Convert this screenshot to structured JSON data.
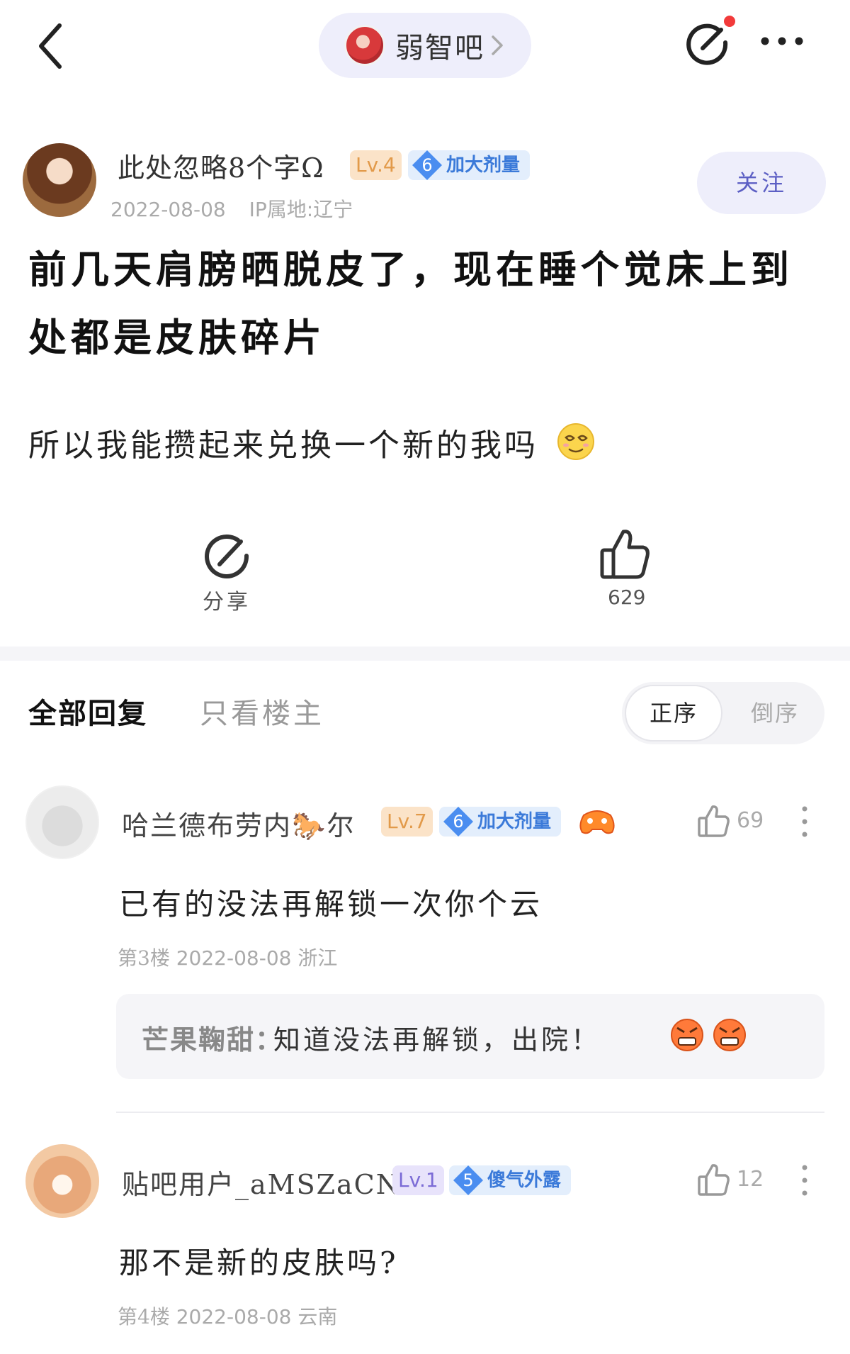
{
  "topbar": {
    "forum_name": "弱智吧",
    "icons": [
      "back-icon",
      "chevron-right-icon",
      "share-icon",
      "more-icon"
    ]
  },
  "author": {
    "name": "此处忽略8个字Ω",
    "level": "Lv.4",
    "title_level": "6",
    "title": "加大剂量",
    "date": "2022-08-08",
    "ip": "IP属地:辽宁",
    "follow_label": "关注"
  },
  "post": {
    "title": "前几天肩膀晒脱皮了，现在睡个觉床上到处都是皮肤碎片",
    "body": "所以我能攒起来兑换一个新的我吗"
  },
  "actions": {
    "share_label": "分享",
    "like_count": "629"
  },
  "tabs": {
    "all": "全部回复",
    "op_only": "只看楼主",
    "sort_asc": "正序",
    "sort_desc": "倒序"
  },
  "replies": [
    {
      "name": "哈兰德布劳内🐎尔",
      "level": "Lv.7",
      "title_level": "6",
      "title": "加大剂量",
      "likes": "69",
      "text": "已有的没法再解锁一次你个云",
      "floor": "第3楼",
      "date": "2022-08-08",
      "location": "浙江",
      "sub_reply": {
        "user": "芒果鞠甜：",
        "text": "知道没法再解锁，出院！"
      }
    },
    {
      "name": "贴吧用户_aMSZaCN",
      "level": "Lv.1",
      "title_level": "5",
      "title": "傻气外露",
      "likes": "12",
      "text": "那不是新的皮肤吗?",
      "floor": "第4楼",
      "date": "2022-08-08",
      "location": "云南"
    }
  ],
  "colors": {
    "accent": "#5c5fc4",
    "pill_bg": "#eeeefb",
    "notif_dot": "#f23a3a",
    "badge_blue": "#3b7ad9"
  }
}
